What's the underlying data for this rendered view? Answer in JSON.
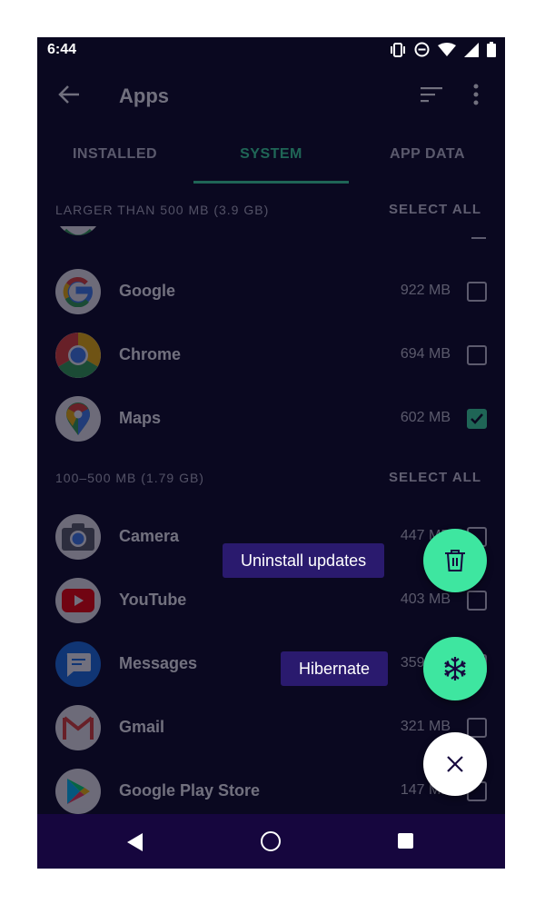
{
  "status_bar": {
    "time": "6:44"
  },
  "app_bar": {
    "title": "Apps"
  },
  "tabs": [
    {
      "label": "INSTALLED",
      "active": false
    },
    {
      "label": "SYSTEM",
      "active": true
    },
    {
      "label": "APP DATA",
      "active": false
    }
  ],
  "sections": [
    {
      "label": "LARGER THAN 500 MB (3.9 GB)",
      "select_all": "SELECT ALL",
      "apps": [
        {
          "name": "Google",
          "size": "922 MB",
          "checked": false
        },
        {
          "name": "Chrome",
          "size": "694 MB",
          "checked": false
        },
        {
          "name": "Maps",
          "size": "602 MB",
          "checked": true
        }
      ]
    },
    {
      "label": "100–500 MB (1.79 GB)",
      "select_all": "SELECT ALL",
      "apps": [
        {
          "name": "Camera",
          "size": "447 MB",
          "checked": false
        },
        {
          "name": "YouTube",
          "size": "403 MB",
          "checked": false
        },
        {
          "name": "Messages",
          "size": "359 MB",
          "checked": false
        },
        {
          "name": "Gmail",
          "size": "321 MB",
          "checked": false
        },
        {
          "name": "Google Play Store",
          "size": "147 MB",
          "checked": false
        }
      ]
    }
  ],
  "fab_menu": {
    "uninstall_label": "Uninstall updates",
    "hibernate_label": "Hibernate"
  },
  "colors": {
    "accent": "#3ee6a0",
    "background": "#0a0820",
    "navbar": "#16063e",
    "tooltip": "#2a1a6e"
  }
}
